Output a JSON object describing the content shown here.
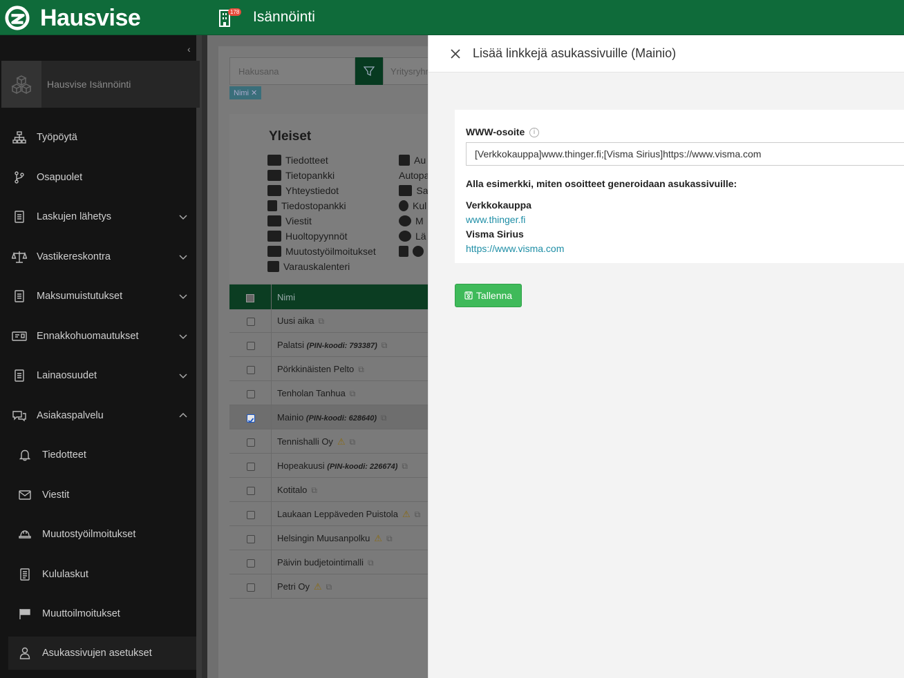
{
  "app": {
    "brand": "Hausvise",
    "section_title": "Isännöinti",
    "notification_count": "178"
  },
  "sidebar": {
    "org_name": "Hausvise Isännöinti",
    "items": [
      {
        "label": "Työpöytä",
        "icon": "sitemap-icon"
      },
      {
        "label": "Osapuolet",
        "icon": "branch-icon"
      },
      {
        "label": "Laskujen lähetys",
        "icon": "document-icon"
      },
      {
        "label": "Vastikereskontra",
        "icon": "scale-icon"
      },
      {
        "label": "Maksumuistutukset",
        "icon": "document-icon"
      },
      {
        "label": "Ennakkohuomautukset",
        "icon": "envelope-card-icon"
      },
      {
        "label": "Lainaosuudet",
        "icon": "document-icon"
      },
      {
        "label": "Asiakaspalvelu",
        "icon": "chat-icon"
      },
      {
        "label": "Tiedotteet",
        "icon": "bell-icon"
      },
      {
        "label": "Viestit",
        "icon": "envelope-icon"
      },
      {
        "label": "Muutostyöilmoitukset",
        "icon": "hardhat-icon"
      },
      {
        "label": "Kululaskut",
        "icon": "receipt-icon"
      },
      {
        "label": "Muuttoilmoitukset",
        "icon": "flag-icon"
      },
      {
        "label": "Asukassivujen asetukset",
        "icon": "user-icon"
      }
    ]
  },
  "main": {
    "search_placeholder": "Hakusana",
    "company_placeholder": "Yritysryhmä",
    "filter_tag": "Nimi ✕",
    "yleiset_title": "Yleiset",
    "yleiset_left": [
      "Tiedotteet",
      "Tietopankki",
      "Yhteystiedot",
      "Tiedostopankki",
      "Viestit",
      "Huoltopyynnöt",
      "Muutostyöilmoitukset",
      "Varauskalenteri"
    ],
    "yleiset_right": [
      "Au",
      "Autopa",
      "Sa",
      "Kul",
      "M",
      "Lä",
      ""
    ],
    "table_header": "Nimi",
    "rows": [
      {
        "name": "Uusi aika",
        "pin": "",
        "warn": false,
        "checked": false
      },
      {
        "name": "Palatsi",
        "pin": "(PIN-koodi: 793387)",
        "warn": false,
        "checked": false
      },
      {
        "name": "Pörkkinäisten Pelto",
        "pin": "",
        "warn": false,
        "checked": false
      },
      {
        "name": "Tenholan Tanhua",
        "pin": "",
        "warn": false,
        "checked": false
      },
      {
        "name": "Mainio",
        "pin": "(PIN-koodi: 628640)",
        "warn": false,
        "checked": true
      },
      {
        "name": "Tennishalli Oy",
        "pin": "",
        "warn": true,
        "checked": false
      },
      {
        "name": "Hopeakuusi",
        "pin": "(PIN-koodi: 226674)",
        "warn": false,
        "checked": false
      },
      {
        "name": "Kotitalo",
        "pin": "",
        "warn": false,
        "checked": false
      },
      {
        "name": "Laukaan Leppäveden Puistola",
        "pin": "",
        "warn": true,
        "checked": false
      },
      {
        "name": "Helsingin Muusanpolku",
        "pin": "",
        "warn": true,
        "checked": false
      },
      {
        "name": "Päivin budjetointimalli",
        "pin": "",
        "warn": false,
        "checked": false
      },
      {
        "name": "Petri Oy",
        "pin": "",
        "warn": true,
        "checked": false
      }
    ]
  },
  "panel": {
    "title": "Lisää linkkejä asukassivuille (Mainio)",
    "field_label": "WWW-osoite",
    "field_value": "[Verkkokauppa]www.thinger.fi;[Visma Sirius]https://www.visma.com",
    "hint": "Alla esimerkki, miten osoitteet generoidaan asukassivuille:",
    "examples": [
      {
        "name": "Verkkokauppa",
        "url": "www.thinger.fi"
      },
      {
        "name": "Visma Sirius",
        "url": "https://www.visma.com"
      }
    ],
    "save_label": "Tallenna"
  },
  "colors": {
    "brand_green": "#0f6b3a",
    "save_green": "#3fba5a",
    "link": "#1e8ea6"
  }
}
